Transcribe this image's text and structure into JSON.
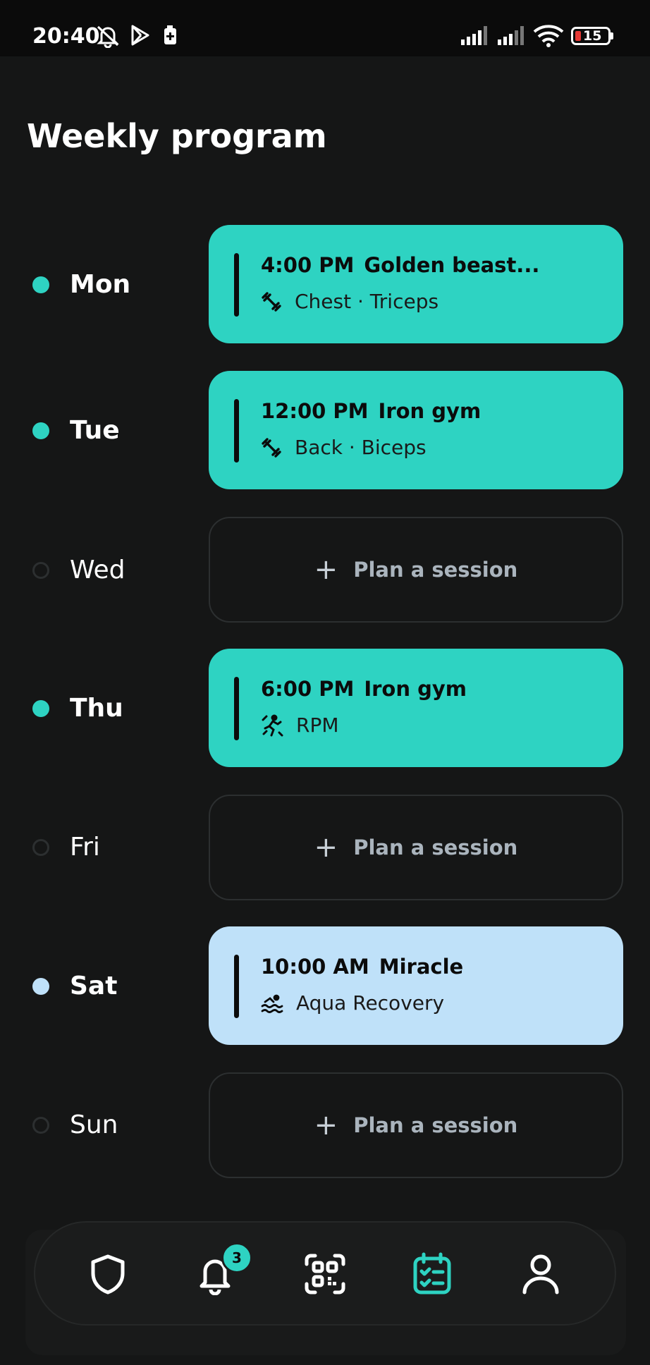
{
  "status_bar": {
    "time": "20:40",
    "battery_level": "15"
  },
  "page": {
    "title": "Weekly program"
  },
  "days": [
    {
      "day": "Mon",
      "scheduled": true,
      "time": "4:00 PM",
      "gym": "Golden beast...",
      "activity": "Chest · Triceps",
      "icon": "dumbbell-icon",
      "color": "#2ed3c2"
    },
    {
      "day": "Tue",
      "scheduled": true,
      "time": "12:00 PM",
      "gym": "Iron gym",
      "activity": "Back · Biceps",
      "icon": "dumbbell-icon",
      "color": "#2ed3c2"
    },
    {
      "day": "Wed",
      "scheduled": false,
      "plan_label": "Plan a session"
    },
    {
      "day": "Thu",
      "scheduled": true,
      "time": "6:00 PM",
      "gym": "Iron gym",
      "activity": "RPM",
      "icon": "cycling-icon",
      "color": "#2ed3c2"
    },
    {
      "day": "Fri",
      "scheduled": false,
      "plan_label": "Plan a session"
    },
    {
      "day": "Sat",
      "scheduled": true,
      "time": "10:00 AM",
      "gym": "Miracle",
      "activity": "Aqua Recovery",
      "icon": "swimming-icon",
      "color": "#bfe1f9"
    },
    {
      "day": "Sun",
      "scheduled": false,
      "plan_label": "Plan a session"
    }
  ],
  "nav": {
    "items": [
      "shield-icon",
      "bell-icon",
      "qr-code-icon",
      "calendar-check-icon",
      "profile-icon"
    ],
    "active": "calendar-check-icon",
    "notification_count": "3"
  },
  "colors": {
    "accent": "#2ed3c2",
    "recovery": "#bfe1f9",
    "background": "#151616"
  }
}
